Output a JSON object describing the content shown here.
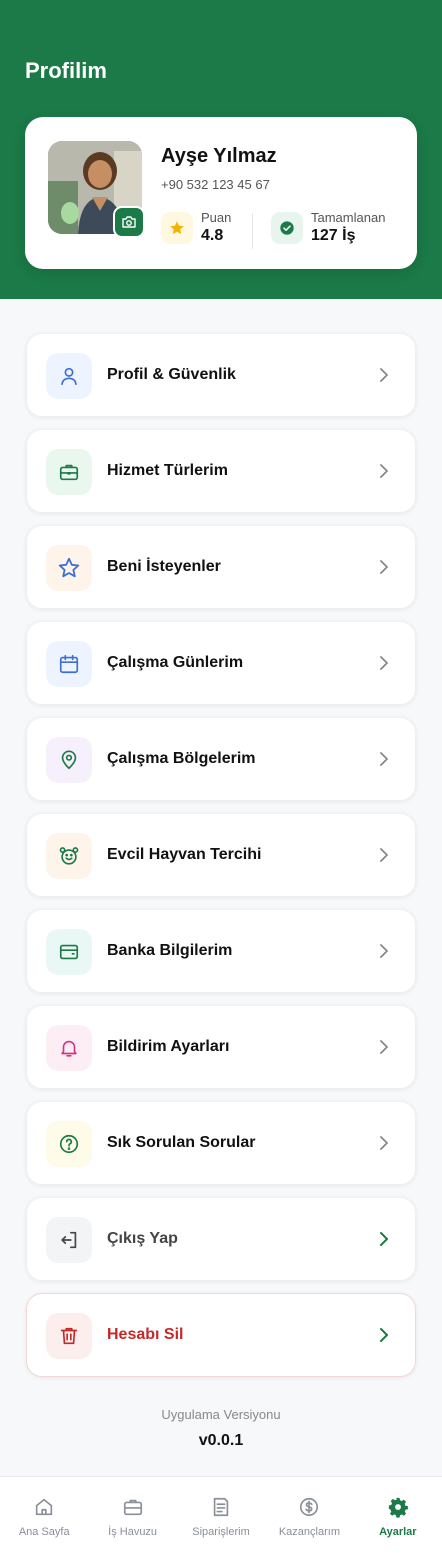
{
  "page": {
    "title": "Profilim"
  },
  "profile": {
    "name": "Ayşe Yılmaz",
    "phone": "+90 532 123 45 67",
    "rating_label": "Puan",
    "rating_value": "4.8",
    "completed_label": "Tamamlanan",
    "completed_value": "127 İş"
  },
  "menu": {
    "items": [
      {
        "label": "Profil & Güvenlik",
        "icon": "user-icon",
        "icon_bg": "#eef4ff",
        "icon_color": "#3b6fd6"
      },
      {
        "label": "Hizmet Türlerim",
        "icon": "briefcase-icon",
        "icon_bg": "#eaf7ef",
        "icon_color": "#1b7a47"
      },
      {
        "label": "Beni İsteyenler",
        "icon": "star-icon",
        "icon_bg": "#fff4ea",
        "icon_color": "#3b6fd6"
      },
      {
        "label": "Çalışma Günlerim",
        "icon": "calendar-icon",
        "icon_bg": "#eef4ff",
        "icon_color": "#3b6fd6"
      },
      {
        "label": "Çalışma Bölgelerim",
        "icon": "location-pin-icon",
        "icon_bg": "#f6effc",
        "icon_color": "#1b7a47"
      },
      {
        "label": "Evcil Hayvan Tercihi",
        "icon": "pet-icon",
        "icon_bg": "#fff4ea",
        "icon_color": "#1b7a47"
      },
      {
        "label": "Banka Bilgilerim",
        "icon": "wallet-icon",
        "icon_bg": "#eaf8f5",
        "icon_color": "#1b7a47"
      },
      {
        "label": "Bildirim Ayarları",
        "icon": "bell-icon",
        "icon_bg": "#fdeef5",
        "icon_color": "#d63384"
      },
      {
        "label": "Sık Sorulan Sorular",
        "icon": "help-circle-icon",
        "icon_bg": "#fefbe8",
        "icon_color": "#1b7a47"
      },
      {
        "label": "Çıkış Yap",
        "icon": "logout-icon",
        "icon_bg": "#f3f4f6",
        "icon_color": "#444444"
      },
      {
        "label": "Hesabı Sil",
        "icon": "trash-icon",
        "icon_bg": "#fdeeee",
        "icon_color": "#c62828"
      }
    ]
  },
  "version": {
    "label": "Uygulama Versiyonu",
    "value": "v0.0.1"
  },
  "bottom_nav": {
    "items": [
      {
        "label": "Ana Sayfa",
        "icon": "home-icon"
      },
      {
        "label": "İş Havuzu",
        "icon": "briefcase-icon"
      },
      {
        "label": "Siparişlerim",
        "icon": "receipt-icon"
      },
      {
        "label": "Kazançlarım",
        "icon": "dollar-circle-icon"
      },
      {
        "label": "Ayarlar",
        "icon": "gear-icon"
      }
    ],
    "active": "Ayarlar"
  },
  "colors": {
    "brand": "#1b7a47",
    "danger": "#c62828",
    "background": "#f7f8fa"
  }
}
